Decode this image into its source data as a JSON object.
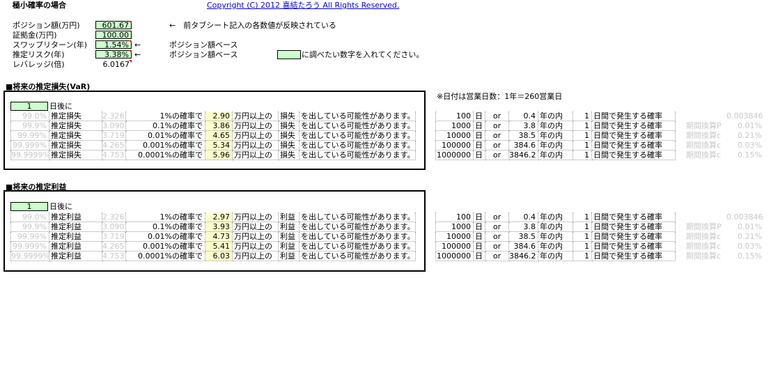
{
  "header": {
    "title": "極小確率の場合",
    "copyright": "Copyright (C) 2012 喜結たろう All Rights Reserved."
  },
  "params": {
    "position_label": "ポジション額(万円)",
    "position_value": "601.67",
    "margin_label": "証拠金(万円)",
    "margin_value": "100.00",
    "swap_label": "スワップリターン(年)",
    "swap_value": "1.54%",
    "risk_label": "推定リスク(年)",
    "risk_value": "3.38%",
    "leverage_label": "レバレッジ(倍)",
    "leverage_value": "6.0167",
    "note_prev_tab": "←　前タブシート記入の各数値が反映されている",
    "arrow": "←",
    "position_base": "ポジション額ベース",
    "legend_text": "に調べたい数字を入れてください。",
    "business_days_note": "※日付は営業日数：1年＝260営業日"
  },
  "var_section": {
    "heading": "■将来の推定損失(VaR)",
    "days_value": "1",
    "days_label": "日後に",
    "rows": [
      {
        "pct": "99.0%",
        "label": "推定損失",
        "z": "2.326",
        "prob": "1%の確率で",
        "amount": "2.90",
        "unit": "万円以上の",
        "kind": "損失",
        "tail": "を出している可能性があります。"
      },
      {
        "pct": "99.9%",
        "label": "推定損失",
        "z": "3.090",
        "prob": "0.1%の確率で",
        "amount": "3.86",
        "unit": "万円以上の",
        "kind": "損失",
        "tail": "を出している可能性があります。"
      },
      {
        "pct": "99.99%",
        "label": "推定損失",
        "z": "3.719",
        "prob": "0.01%の確率で",
        "amount": "4.65",
        "unit": "万円以上の",
        "kind": "損失",
        "tail": "を出している可能性があります。"
      },
      {
        "pct": "99.999%",
        "label": "推定損失",
        "z": "4.265",
        "prob": "0.001%の確率で",
        "amount": "5.34",
        "unit": "万円以上の",
        "kind": "損失",
        "tail": "を出している可能性があります。"
      },
      {
        "pct": "99.9999%",
        "label": "推定損失",
        "z": "4.753",
        "prob": "0.0001%の確率で",
        "amount": "5.96",
        "unit": "万円以上の",
        "kind": "損失",
        "tail": "を出している可能性があります。"
      }
    ],
    "freq_rows": [
      {
        "days": "100",
        "d": "日",
        "or": "or",
        "years": "0.4",
        "yin": "年の内",
        "one": "1",
        "desc": "日間で発生する確率",
        "k": "",
        "v": "0.003846"
      },
      {
        "days": "1000",
        "d": "日",
        "or": "or",
        "years": "3.8",
        "yin": "年の内",
        "one": "1",
        "desc": "日間で発生する確率",
        "k": "期間換算P",
        "v": "0.01%"
      },
      {
        "days": "10000",
        "d": "日",
        "or": "or",
        "years": "38.5",
        "yin": "年の内",
        "one": "1",
        "desc": "日間で発生する確率",
        "k": "期間換算c",
        "v": "0.21%"
      },
      {
        "days": "100000",
        "d": "日",
        "or": "or",
        "years": "384.6",
        "yin": "年の内",
        "one": "1",
        "desc": "日間で発生する確率",
        "k": "期間換算c",
        "v": "0.03%"
      },
      {
        "days": "1000000",
        "d": "日",
        "or": "or",
        "years": "3846.2",
        "yin": "年の内",
        "one": "1",
        "desc": "日間で発生する確率",
        "k": "期間換算c",
        "v": "0.15%"
      }
    ]
  },
  "profit_section": {
    "heading": "■将来の推定利益",
    "days_value": "1",
    "days_label": "日後に",
    "rows": [
      {
        "pct": "99.0%",
        "label": "推定利益",
        "z": "2.326",
        "prob": "1%の確率で",
        "amount": "2.97",
        "unit": "万円以上の",
        "kind": "利益",
        "tail": "を出している可能性があります。"
      },
      {
        "pct": "99.9%",
        "label": "推定利益",
        "z": "3.090",
        "prob": "0.1%の確率で",
        "amount": "3.93",
        "unit": "万円以上の",
        "kind": "利益",
        "tail": "を出している可能性があります。"
      },
      {
        "pct": "99.99%",
        "label": "推定利益",
        "z": "3.719",
        "prob": "0.01%の確率で",
        "amount": "4.73",
        "unit": "万円以上の",
        "kind": "利益",
        "tail": "を出している可能性があります。"
      },
      {
        "pct": "99.999%",
        "label": "推定利益",
        "z": "4.265",
        "prob": "0.001%の確率で",
        "amount": "5.41",
        "unit": "万円以上の",
        "kind": "利益",
        "tail": "を出している可能性があります。"
      },
      {
        "pct": "99.9999%",
        "label": "推定利益",
        "z": "4.753",
        "prob": "0.0001%の確率で",
        "amount": "6.03",
        "unit": "万円以上の",
        "kind": "利益",
        "tail": "を出している可能性があります。"
      }
    ],
    "freq_rows": [
      {
        "days": "100",
        "d": "日",
        "or": "or",
        "years": "0.4",
        "yin": "年の内",
        "one": "1",
        "desc": "日間で発生する確率",
        "k": "",
        "v": "0.003846"
      },
      {
        "days": "1000",
        "d": "日",
        "or": "or",
        "years": "3.8",
        "yin": "年の内",
        "one": "1",
        "desc": "日間で発生する確率",
        "k": "期間換算P",
        "v": "0.01%"
      },
      {
        "days": "10000",
        "d": "日",
        "or": "or",
        "years": "38.5",
        "yin": "年の内",
        "one": "1",
        "desc": "日間で発生する確率",
        "k": "期間換算c",
        "v": "0.21%"
      },
      {
        "days": "100000",
        "d": "日",
        "or": "or",
        "years": "384.6",
        "yin": "年の内",
        "one": "1",
        "desc": "日間で発生する確率",
        "k": "期間換算c",
        "v": "0.03%"
      },
      {
        "days": "1000000",
        "d": "日",
        "or": "or",
        "years": "3846.2",
        "yin": "年の内",
        "one": "1",
        "desc": "日間で発生する確率",
        "k": "期間換算c",
        "v": "0.15%"
      }
    ]
  }
}
